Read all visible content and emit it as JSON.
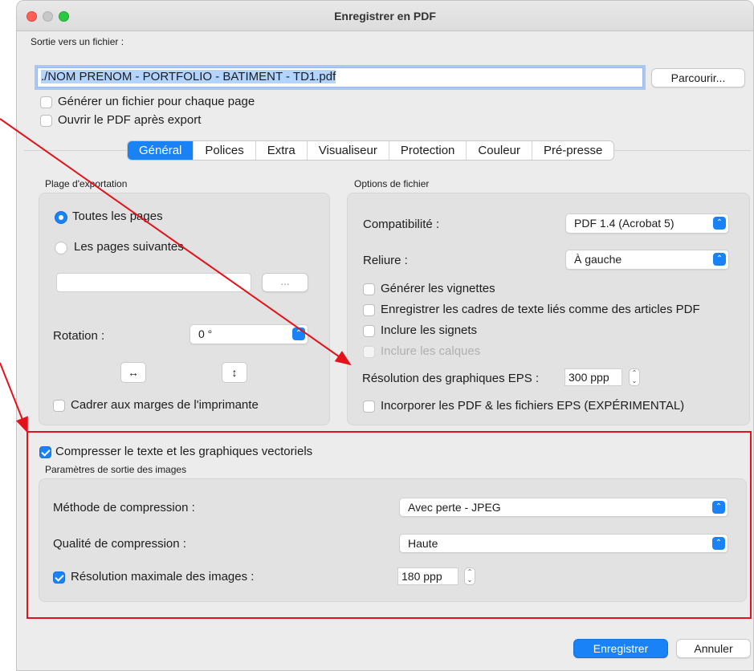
{
  "window": {
    "title": "Enregistrer en PDF"
  },
  "output": {
    "section_label": "Sortie vers un fichier :",
    "file_path": "./NOM PRENOM - PORTFOLIO - BATIMENT - TD1.pdf",
    "browse_label": "Parcourir...",
    "file_per_page_label": "Générer un fichier pour chaque page",
    "open_after_label": "Ouvrir le PDF après export"
  },
  "tabs": [
    {
      "label": "Général",
      "active": true
    },
    {
      "label": "Polices"
    },
    {
      "label": "Extra"
    },
    {
      "label": "Visualiseur"
    },
    {
      "label": "Protection"
    },
    {
      "label": "Couleur"
    },
    {
      "label": "Pré-presse"
    }
  ],
  "export_range": {
    "title": "Plage d'exportation",
    "all_pages_label": "Toutes les pages",
    "following_pages_label": "Les pages suivantes",
    "page_field_value": "",
    "more_button_label": "...",
    "rotation_label": "Rotation :",
    "rotation_value": "0 °",
    "flip_h_icon": "↔",
    "flip_v_icon": "↕",
    "fit_margins_label": "Cadrer aux marges de l'imprimante"
  },
  "file_options": {
    "title": "Options de fichier",
    "compat_label": "Compatibilité :",
    "compat_value": "PDF 1.4 (Acrobat 5)",
    "binding_label": "Reliure :",
    "binding_value": "À gauche",
    "thumbnails_label": "Générer les vignettes",
    "linked_frames_label": "Enregistrer les cadres de texte liés comme des articles PDF",
    "bookmarks_label": "Inclure les signets",
    "layers_label": "Inclure les calques",
    "eps_res_label": "Résolution des graphiques EPS :",
    "eps_res_value": "300 ppp",
    "embed_label": "Incorporer les PDF & les fichiers EPS (EXPÉRIMENTAL)"
  },
  "compression": {
    "compress_label": "Compresser le texte et les graphiques vectoriels",
    "image_params_title": "Paramètres de sortie des images",
    "method_label": "Méthode de compression :",
    "method_value": "Avec perte - JPEG",
    "quality_label": "Qualité de compression :",
    "quality_value": "Haute",
    "max_res_label": "Résolution maximale des images :",
    "max_res_value": "180 ppp"
  },
  "footer": {
    "save_label": "Enregistrer",
    "cancel_label": "Annuler"
  },
  "colors": {
    "accent": "#1a82f7",
    "annotation_red": "#e3131b"
  }
}
